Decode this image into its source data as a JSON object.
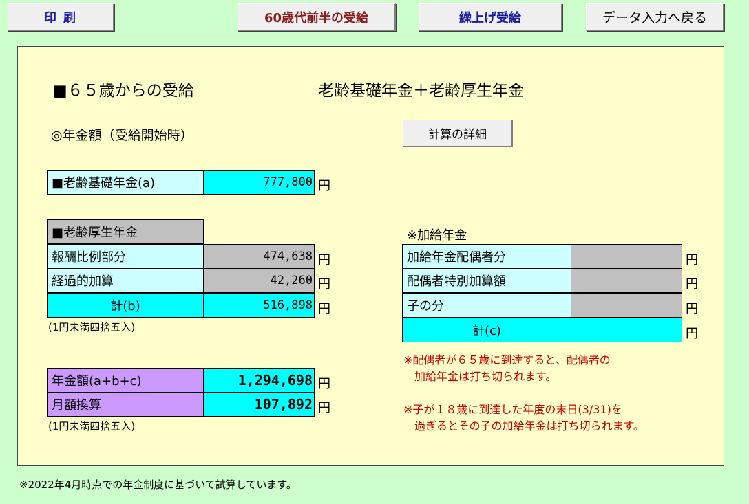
{
  "toolbar": {
    "print_label": "印刷",
    "sixties_label": "60歳代前半の受給",
    "early_label": "繰上げ受給",
    "back_label": "データ入力へ戻る"
  },
  "panel": {
    "title": "■６５歳からの受給",
    "title_right": "老齢基礎年金＋老齢厚生年金",
    "amount_heading": "◎年金額（受給開始時）",
    "calc_detail_label": "計算の詳細"
  },
  "basic": {
    "label": "■老齢基礎年金(a)",
    "value": "777,800",
    "unit": "円"
  },
  "welfare": {
    "header": "■老齢厚生年金",
    "rows": [
      {
        "label": "報酬比例部分",
        "value": "474,638",
        "unit": "円"
      },
      {
        "label": "経過的加算",
        "value": "42,260",
        "unit": "円"
      }
    ],
    "total_label": "計(b)",
    "total_value": "516,898",
    "total_unit": "円",
    "note": "(1円未満四捨五入)"
  },
  "summary": {
    "rows": [
      {
        "label": "年金額(a+b+c)",
        "value": "1,294,698",
        "unit": "円"
      },
      {
        "label": "月額換算",
        "value": "107,892",
        "unit": "円"
      }
    ],
    "note": "(1円未満四捨五入)"
  },
  "additional": {
    "header": "※加給年金",
    "rows": [
      {
        "label": "加給年金配偶者分",
        "value": "",
        "unit": "円"
      },
      {
        "label": "配偶者特別加算額",
        "value": "",
        "unit": "円"
      },
      {
        "label": "子の分",
        "value": "",
        "unit": "円"
      }
    ],
    "total_label": "計(c)",
    "total_value": "",
    "total_unit": "円"
  },
  "notes": {
    "spouse": "※配偶者が６５歳に到達すると、配偶者の\n　加給年金は打ち切られます。",
    "child": "※子が１８歳に到達した年度の末日(3/31)を\n　過ぎるとその子の加給年金は打ち切られます。"
  },
  "footer": "※2022年4月時点での年金制度に基づいて試算しています。",
  "colors": {
    "background": "#ccffcc",
    "panel": "#ffffcc",
    "cyan": "#00ffff",
    "light_cyan": "#ccffff",
    "gray": "#c0c0c0",
    "purple": "#cc99ff",
    "note_red": "#cc0000"
  }
}
